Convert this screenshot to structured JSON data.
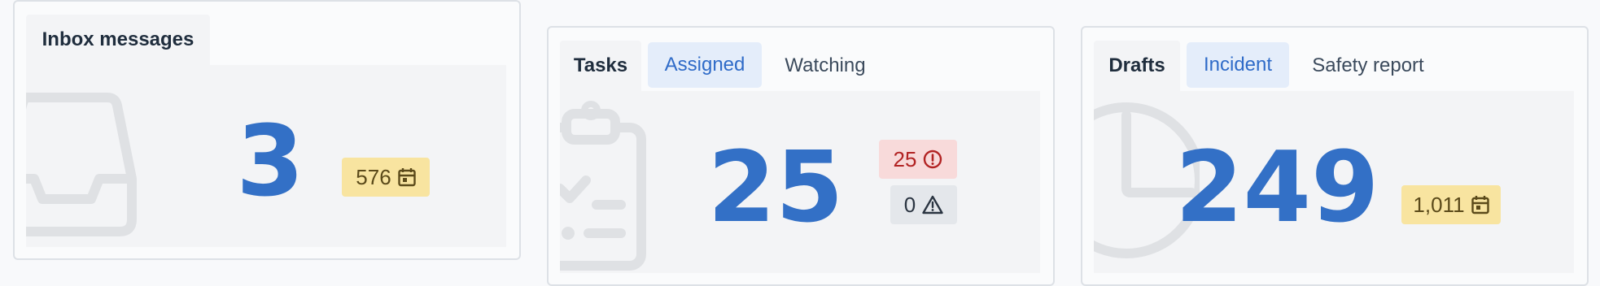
{
  "widgets": [
    {
      "tabs": [
        "Inbox messages"
      ],
      "count": "3",
      "icon": "inbox-icon",
      "badges": [
        {
          "value": "576",
          "icon": "calendar-icon",
          "color": "#f8e4a0"
        }
      ]
    },
    {
      "tabs": [
        "Tasks",
        "Assigned",
        "Watching"
      ],
      "selected_tab": "Assigned",
      "count": "25",
      "icon": "clipboard-icon",
      "badges": [
        {
          "value": "25",
          "icon": "alert-circle-icon",
          "color": "#f8dada"
        },
        {
          "value": "0",
          "icon": "warning-triangle-icon",
          "color": "#e4e7eb"
        }
      ]
    },
    {
      "tabs": [
        "Drafts",
        "Incident",
        "Safety report"
      ],
      "selected_tab": "Incident",
      "count": "249",
      "icon": "clock-icon",
      "badges": [
        {
          "value": "1,011",
          "icon": "calendar-icon",
          "color": "#f8e4a0"
        }
      ]
    }
  ],
  "colors": {
    "accent": "#3370c6",
    "selected_tab_bg": "#e4edfa",
    "panel_bg": "#f3f4f6"
  }
}
